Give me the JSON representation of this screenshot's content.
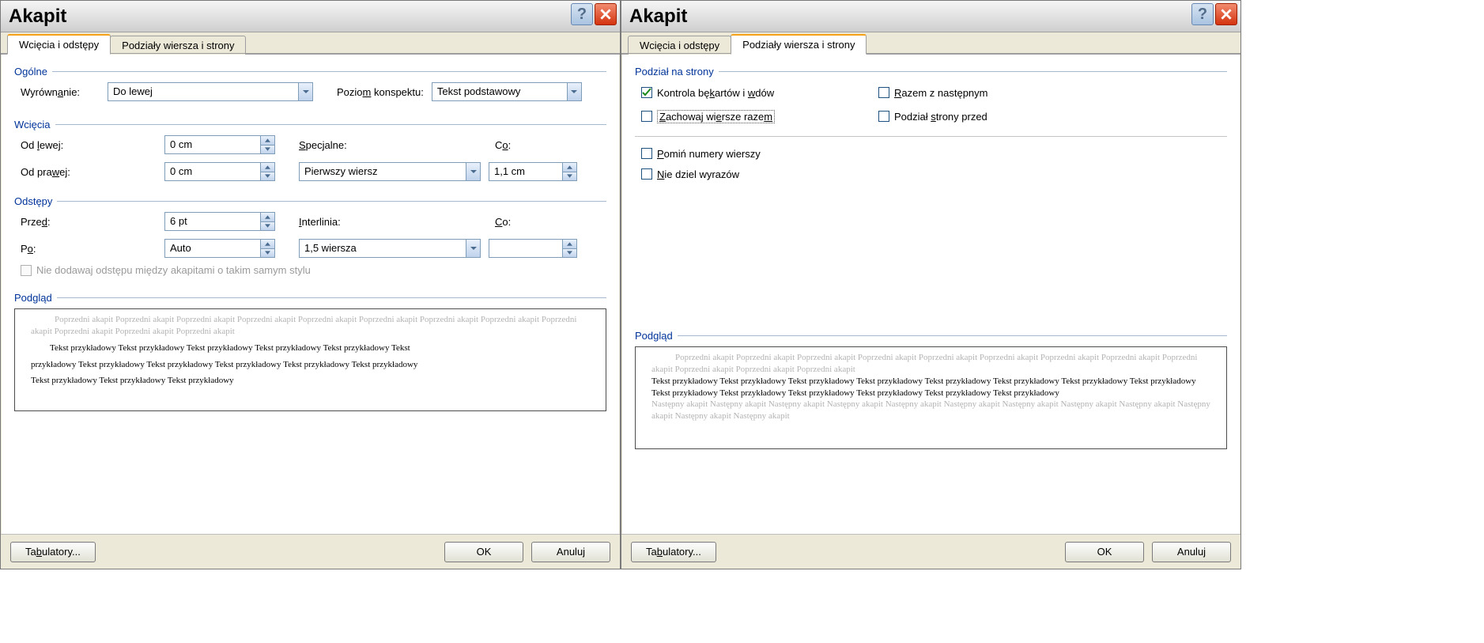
{
  "titles": {
    "left": "Akapit",
    "right": "Akapit"
  },
  "tabs": {
    "indent": "Wcięcia i odstępy",
    "breaks": "Podziały wiersza i strony"
  },
  "groups": {
    "general": "Ogólne",
    "indent": "Wcięcia",
    "spacing": "Odstępy",
    "preview": "Podgląd",
    "pagination": "Podział na strony"
  },
  "labels": {
    "alignment_pre": "Wyrówn",
    "alignment_u": "a",
    "alignment_post": "nie:",
    "outline_pre": "Pozio",
    "outline_u": "m",
    "outline_post": " konspektu:",
    "left_pre": "Od ",
    "left_u": "l",
    "left_post": "ewej:",
    "right_pre": "Od pra",
    "right_u": "w",
    "right_post": "ej:",
    "special_pre": "",
    "special_u": "S",
    "special_post": "pecjalne:",
    "co_pre": "C",
    "co_u": "o",
    "co_post": ":",
    "before_pre": "Prze",
    "before_u": "d",
    "before_post": ":",
    "after_pre": "P",
    "after_u": "o",
    "after_post": ":",
    "linespace_pre": "",
    "linespace_u": "I",
    "linespace_post": "nterlinia:",
    "co2_pre": "",
    "co2_u": "C",
    "co2_post": "o:",
    "nospace": "Nie dodawaj odstępu między akapitami o takim samym stylu",
    "widow_pre": "Kontrola bę",
    "widow_u": "k",
    "widow_post": "artów i ",
    "widow_u2": "w",
    "widow_post2": "dów",
    "keeplines_pre": "",
    "keeplines_u": "Z",
    "keeplines_post": "achowaj wi",
    "keeplines_u2": "e",
    "keeplines_post2": "rsze raze",
    "keeplines_u3": "m",
    "keeplines_post3": "",
    "keepnext_pre": "",
    "keepnext_u": "R",
    "keepnext_post": "azem z następnym",
    "pagebreak_pre": "Podział ",
    "pagebreak_u": "s",
    "pagebreak_post": "trony przed",
    "suppress_pre": "",
    "suppress_u": "P",
    "suppress_post": "omiń numery wierszy",
    "nohyph_pre": "",
    "nohyph_u": "N",
    "nohyph_post": "ie dziel wyrazów"
  },
  "values": {
    "alignment": "Do lewej",
    "outline": "Tekst podstawowy",
    "left": "0 cm",
    "right": "0 cm",
    "special": "Pierwszy wiersz",
    "co": "1,1 cm",
    "before": "6 pt",
    "after": "Auto",
    "linespace": "1,5 wiersza",
    "co2": ""
  },
  "buttons": {
    "tabs_pre": "Ta",
    "tabs_u": "b",
    "tabs_post": "ulatory...",
    "ok": "OK",
    "cancel": "Anuluj"
  },
  "preview": {
    "prev": "Poprzedni akapit Poprzedni akapit Poprzedni akapit Poprzedni akapit Poprzedni akapit Poprzedni akapit Poprzedni akapit Poprzedni akapit Poprzedni akapit Poprzedni akapit Poprzedni akapit Poprzedni akapit",
    "sample1": "Tekst przykładowy Tekst przykładowy Tekst przykładowy Tekst przykładowy Tekst przykładowy Tekst",
    "sample2": "przykładowy Tekst przykładowy Tekst przykładowy Tekst przykładowy Tekst przykładowy Tekst przykładowy",
    "sample3": "Tekst przykładowy Tekst przykładowy Tekst przykładowy",
    "r_sample1": "Tekst przykładowy Tekst przykładowy Tekst przykładowy Tekst przykładowy Tekst przykładowy Tekst przykładowy Tekst przykładowy Tekst przykładowy Tekst przykładowy Tekst przykładowy Tekst przykładowy Tekst przykładowy Tekst przykładowy Tekst przykładowy",
    "next": "Następny akapit Następny akapit Następny akapit Następny akapit Następny akapit Następny akapit Następny akapit Następny akapit Następny akapit Następny akapit Następny akapit Następny akapit"
  }
}
